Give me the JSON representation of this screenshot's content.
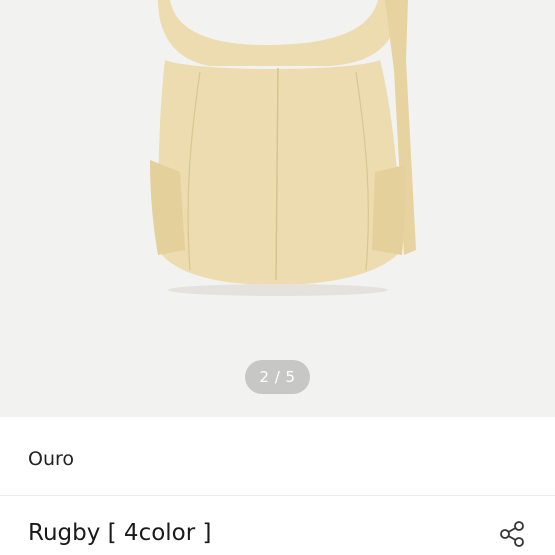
{
  "gallery": {
    "image_label": "product-photo-bag",
    "pager_text": "2 / 5",
    "colors": {
      "background": "#f2f2f0",
      "bag": "#ecdcaf",
      "bag_shadow": "#d9c690"
    }
  },
  "product": {
    "brand": "Ouro",
    "title": "Rugby [ 4color ]",
    "share_icon": "share-icon"
  }
}
